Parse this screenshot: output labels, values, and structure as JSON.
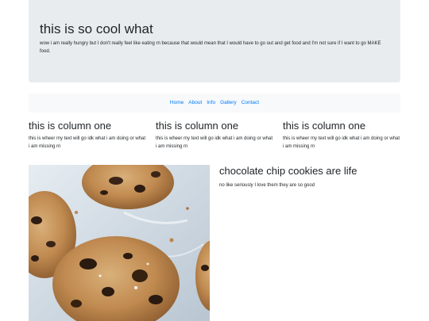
{
  "hero": {
    "title": "this is so cool what",
    "text": "wow i am really hungry but I don't really feel like eating rn because that would mean that I would have to go out and get food and I'm not sure if I want to go MAKE food."
  },
  "nav": {
    "items": [
      "Home",
      "About",
      "Info",
      "Gallery",
      "Contact"
    ]
  },
  "columns": [
    {
      "title": "this is column one",
      "text": "this is wheer my text will go idk what i am doing or what i am missing rn"
    },
    {
      "title": "this is column one",
      "text": "this is wheer my text will go idk what i am doing or what i am missing rn"
    },
    {
      "title": "this is column one",
      "text": "this is wheer my text will go idk what i am doing or what i am missing rn"
    }
  ],
  "feature": {
    "image": "cookies-photo",
    "title": "chocolate chip cookies are life",
    "text": "no like seriously I love them they are so good"
  },
  "colors": {
    "hero_bg": "#e9ecef",
    "nav_bg": "#f8f9fa",
    "link": "#007bff",
    "text": "#212529"
  }
}
